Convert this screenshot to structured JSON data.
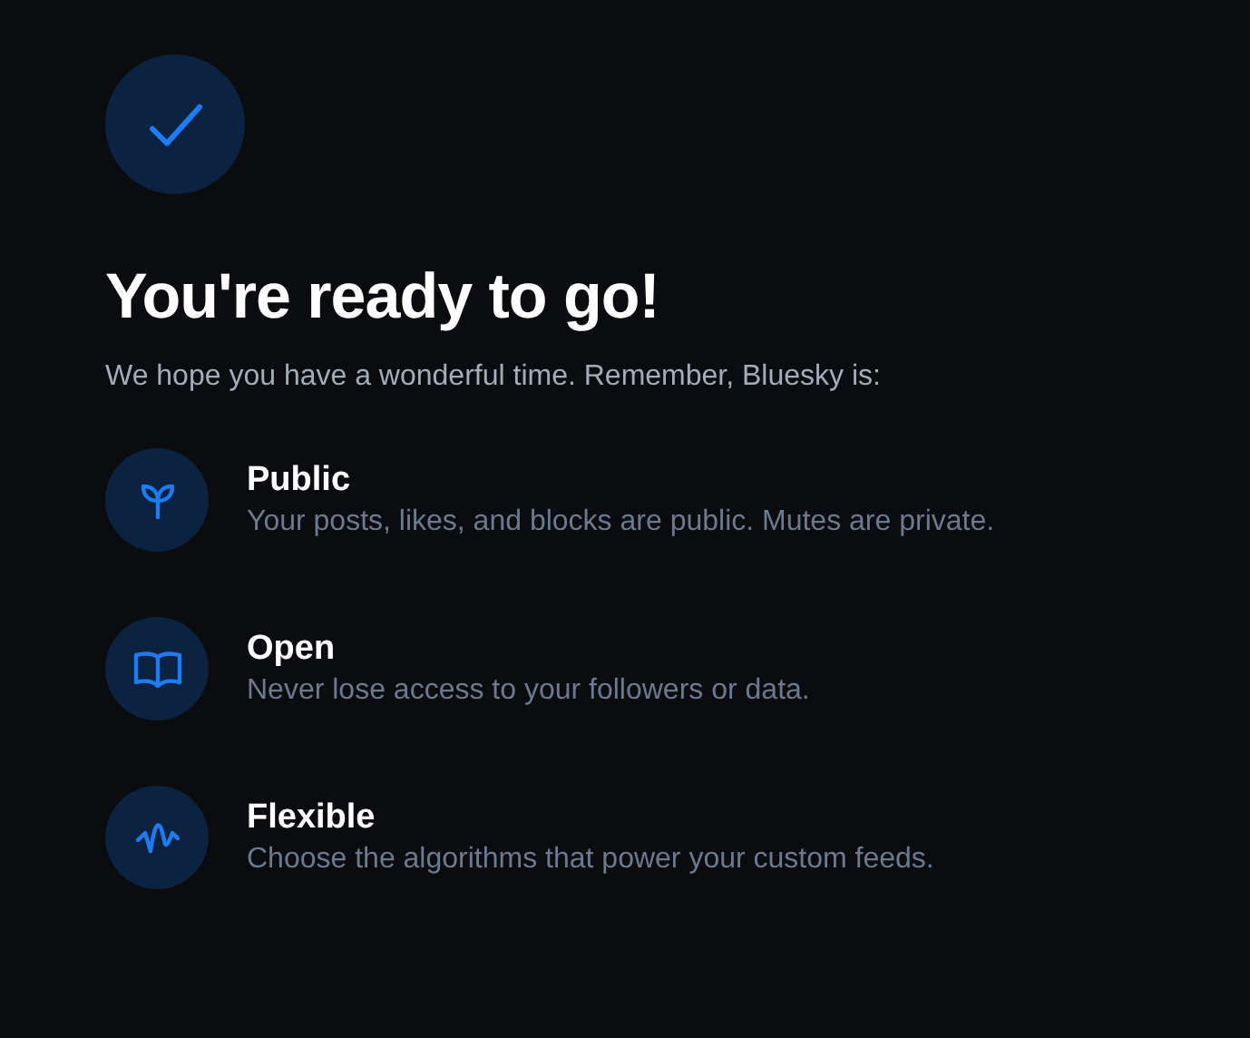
{
  "title": "You're ready to go!",
  "subtitle": "We hope you have a wonderful time. Remember, Bluesky is:",
  "features": [
    {
      "kind": "sprout",
      "title": "Public",
      "description": "Your posts, likes, and blocks are public. Mutes are private."
    },
    {
      "kind": "book",
      "title": "Open",
      "description": "Never lose access to your followers or data."
    },
    {
      "kind": "wave",
      "title": "Flexible",
      "description": "Choose the algorithms that power your custom feeds."
    }
  ]
}
